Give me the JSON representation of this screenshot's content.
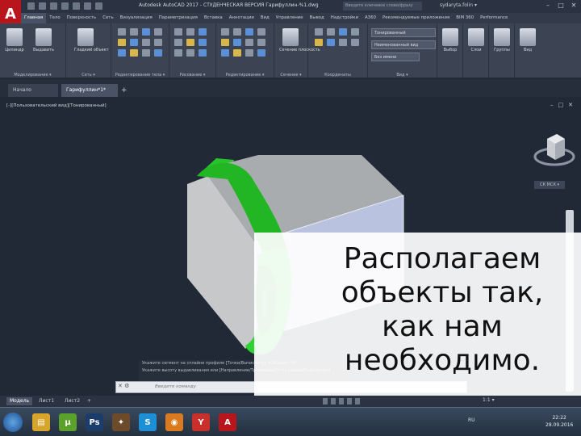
{
  "titlebar": {
    "app_letter": "A",
    "title": "Autodesk AutoCAD 2017 - СТУДЕНЧЕСКАЯ ВЕРСИЯ   Гарифуллин-%1.dwg",
    "search_placeholder": "Введите ключевое слово/фразу",
    "user": "sydaryta.folin ▾"
  },
  "ribbon": {
    "tabs": [
      "Главная",
      "Тело",
      "Поверхность",
      "Сеть",
      "Визуализация",
      "Параметризация",
      "Вставка",
      "Аннотации",
      "Вид",
      "Управление",
      "Вывод",
      "Надстройки",
      "A360",
      "Рекомендуемые приложения",
      "BIM 360",
      "Performance"
    ],
    "active_tab": 0,
    "tools": {
      "cylinder": "Цилиндр",
      "extrude": "Выдавить",
      "smooth_object": "Гладкий объект",
      "section_plane": "Сечение плоскость",
      "select": "Выбор",
      "layers": "Слои",
      "groups": "Группы",
      "view": "Вид"
    },
    "panels": {
      "modeling": "Моделирование ▾",
      "mesh": "Сеть ▾",
      "solid_editing": "Редактирование тела ▾",
      "draw": "Рисование ▾",
      "modify": "Редактирование ▾",
      "section": "Сечение ▾",
      "coordinates": "Координаты",
      "view": "Вид ▾"
    },
    "visual_style": "Тонированный",
    "view_combo": "Неименованный вид",
    "layer_combo": "Без имени"
  },
  "file_tabs": [
    "Начало",
    "Гарифуллин*1*"
  ],
  "file_tab_active": 1,
  "viewport": {
    "label": "[-][Пользовательский вид][Тонированный]",
    "view_label": "СК МСК ▾"
  },
  "command": {
    "history": [
      "Укажите сегмент на сплайне профиле [Точки/Вычислить] <Общий>: 90",
      "Укажите высоту выдавливания или [Направление/Траектория/Угол конуса/Выражение]"
    ],
    "placeholder": "Введите команду"
  },
  "status": {
    "model_tabs": [
      "Модель",
      "Лист1",
      "Лист2"
    ],
    "active_model_tab": 0,
    "scale": "1:1 ▾"
  },
  "taskbar": {
    "apps": [
      {
        "name": "explorer",
        "glyph": "▤",
        "color": "#d6a52a"
      },
      {
        "name": "torrent",
        "glyph": "µ",
        "color": "#5aa22c"
      },
      {
        "name": "photoshop",
        "glyph": "Ps",
        "color": "#1c3d6b"
      },
      {
        "name": "app-fire",
        "glyph": "✦",
        "color": "#6c4a2a"
      },
      {
        "name": "skype",
        "glyph": "S",
        "color": "#1d8fd6"
      },
      {
        "name": "blender",
        "glyph": "◉",
        "color": "#d97a1e"
      },
      {
        "name": "yandex",
        "glyph": "Y",
        "color": "#c9302c"
      },
      {
        "name": "autocad",
        "glyph": "A",
        "color": "#b8161c"
      }
    ],
    "tray": "RU",
    "time": "22:22",
    "date": "28.09.2016"
  },
  "overlay": {
    "text": "Располагаем объекты так, как нам необходимо."
  }
}
